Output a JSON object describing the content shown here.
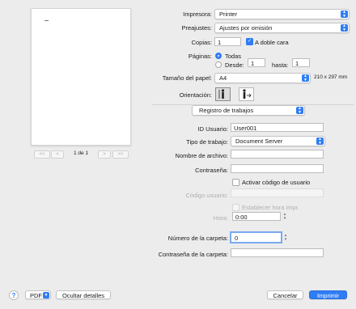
{
  "preview": {
    "page_indicator": "1 de 1",
    "first_label": "<<",
    "prev_label": "<",
    "next_label": ">",
    "last_label": ">>"
  },
  "printer": {
    "label": "Impresora:",
    "value": "Printer"
  },
  "presets": {
    "label": "Preajustes:",
    "value": "Ajustes por omisión"
  },
  "copies": {
    "label": "Copias:",
    "value": "1",
    "two_sided_label": "A doble cara",
    "two_sided_checked": true
  },
  "pages": {
    "label": "Páginas:",
    "all_label": "Todas",
    "from_label": "Desde:",
    "from_value": "1",
    "to_label": "hasta:",
    "to_value": "1",
    "selected": "all"
  },
  "paper": {
    "label": "Tamaño del papel:",
    "value": "A4",
    "dimensions": "210 x 297 mm"
  },
  "orientation": {
    "label": "Orientación:",
    "selected": "portrait"
  },
  "section": {
    "value": "Registro de trabajos"
  },
  "form": {
    "user_id": {
      "label": "ID Usuario:",
      "value": "User001"
    },
    "job_type": {
      "label": "Tipo de trabajo:",
      "value": "Document Server"
    },
    "file_name": {
      "label": "Nombre de archivo:",
      "value": ""
    },
    "password": {
      "label": "Contraseña:",
      "value": ""
    },
    "activate_user_code": {
      "label": "Activar código de usuario",
      "checked": false
    },
    "user_code": {
      "label": "Código usuario:",
      "value": ""
    },
    "set_print_time": {
      "label": "Establecer hora impr.",
      "checked": false
    },
    "time": {
      "label": "Hora:",
      "value": "0:00"
    },
    "folder_number": {
      "label": "Número de la carpeta:",
      "value": "0"
    },
    "folder_password": {
      "label": "Contraseña de la carpeta:",
      "value": ""
    }
  },
  "footer": {
    "help": "?",
    "pdf": "PDF",
    "hide_details": "Ocultar detalles",
    "cancel": "Cancelar",
    "print": "Imprimir"
  },
  "colors": {
    "accent": "#2f7df6",
    "window_bg": "#ececec",
    "disabled_text": "#b0b0b0"
  }
}
